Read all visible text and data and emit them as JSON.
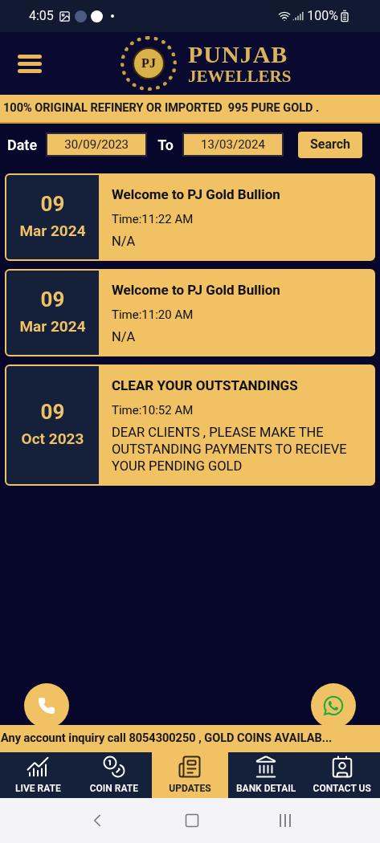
{
  "status_bar": {
    "time": "4:05",
    "battery": "100%"
  },
  "header": {
    "logo_monogram": "PJ",
    "brand_line_1": "PUNJAB",
    "brand_line_2": "JEWELLERS"
  },
  "announcement": "100% ORIGINAL REFINERY OR IMPORTED  995 PURE GOLD .",
  "filter": {
    "from_label": "Date",
    "from_value": "30/09/2023",
    "to_label": "To",
    "to_value": "13/03/2024",
    "button": "Search"
  },
  "updates": [
    {
      "day": "09",
      "month_year": "Mar 2024",
      "title": "Welcome to PJ Gold Bullion",
      "time": "Time:11:22 AM",
      "message": "N/A"
    },
    {
      "day": "09",
      "month_year": "Mar 2024",
      "title": "Welcome to PJ Gold Bullion",
      "time": "Time:11:20 AM",
      "message": "N/A"
    },
    {
      "day": "09",
      "month_year": "Oct 2023",
      "title": "CLEAR YOUR OUTSTANDINGS",
      "time": "Time:10:52 AM",
      "message": "DEAR CLIENTS , PLEASE MAKE THE OUTSTANDING PAYMENTS TO RECIEVE YOUR PENDING GOLD"
    }
  ],
  "footer_ticker": "Any account inquiry call 8054300250 , GOLD COINS AVAILAB...",
  "tabs": [
    {
      "kind": "chart",
      "label": "LIVE RATE",
      "selected": false
    },
    {
      "kind": "coins",
      "label": "COIN RATE",
      "selected": false
    },
    {
      "kind": "news",
      "label": "UPDATES",
      "selected": true
    },
    {
      "kind": "bank",
      "label": "BANK DETAIL",
      "selected": false
    },
    {
      "kind": "contact",
      "label": "CONTACT US",
      "selected": false
    }
  ]
}
